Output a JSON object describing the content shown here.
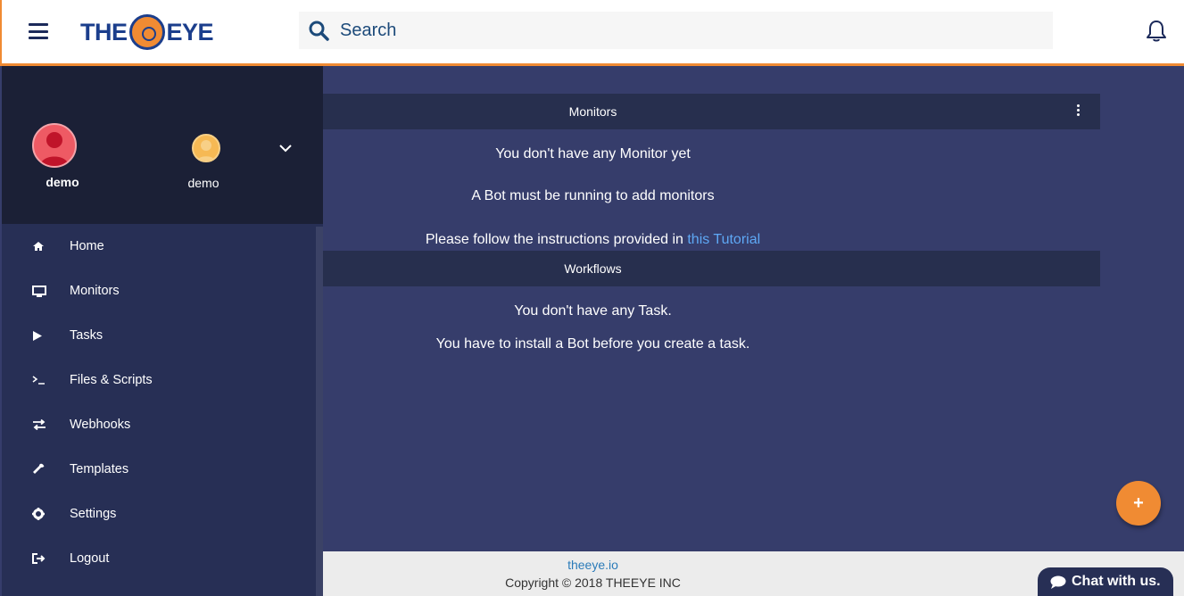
{
  "header": {
    "logo_left": "THE",
    "logo_right": "EYE",
    "search_placeholder": "Search"
  },
  "profile": {
    "main_user": "demo",
    "secondary_user": "demo"
  },
  "sidebar": {
    "items": [
      {
        "label": "Home",
        "icon": "home-icon"
      },
      {
        "label": "Monitors",
        "icon": "desktop-icon"
      },
      {
        "label": "Tasks",
        "icon": "play-icon"
      },
      {
        "label": "Files & Scripts",
        "icon": "terminal-icon"
      },
      {
        "label": "Webhooks",
        "icon": "exchange-icon"
      },
      {
        "label": "Templates",
        "icon": "wrench-icon"
      },
      {
        "label": "Settings",
        "icon": "gear-icon"
      },
      {
        "label": "Logout",
        "icon": "sign-out-icon"
      }
    ]
  },
  "monitors": {
    "title": "Monitors",
    "empty_message": "You don't have any Monitor yet",
    "bot_message": "A Bot must be running to add monitors",
    "instructions_prefix": "Please follow the instructions provided in",
    "tutorial_link": "this Tutorial"
  },
  "workflows": {
    "title": "Workflows",
    "empty_message": "You don't have any Task.",
    "bot_message": "You have to install a Bot before you create a task."
  },
  "footer": {
    "link": "theeye.io",
    "copyright": "Copyright © 2018 THEEYE INC"
  },
  "fab_label": "+",
  "chat_label": "Chat with us.",
  "colors": {
    "accent": "#f08b33",
    "main_bg": "#363d6b",
    "sidebar_bg": "#272f55",
    "profile_bg": "#1b2036",
    "link": "#5ea8f5"
  }
}
